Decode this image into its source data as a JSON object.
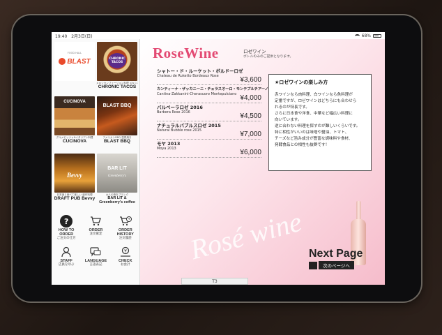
{
  "statusbar": {
    "time": "19:40",
    "date": "2月3日(日)",
    "battery": "68%"
  },
  "sidebar": {
    "restaurants": [
      {
        "sub": "FOOD HALL",
        "name": "BLAST",
        "logo": true
      },
      {
        "sub": "メキシカンフュージョン料理 メキシコタコス",
        "name": "CHRONIC TACOS",
        "badge": "CHRONIC TACOS"
      },
      {
        "sub": "グルメピッツァ&イタリアン料理",
        "name": "CUCINOVA",
        "label": "CUCINOVA"
      },
      {
        "sub": "アメリカンBBQ 温泉焼き",
        "name": "BLAST BBQ",
        "label": "BLAST BBQ"
      },
      {
        "sub": "日本酒と食べて楽しい 創作料理",
        "name": "DRAFT PUB Bevvy",
        "label": "Bevvy"
      },
      {
        "sub": "大人の夜をブランク",
        "name": "BAR LIT & Greenberry's coffee",
        "label": "BAR LIT",
        "label2": "Greenberry's"
      }
    ],
    "actions_row1": [
      {
        "en": "HOW TO ORDER",
        "jp": "ご注文の仕方",
        "icon": "help-icon"
      },
      {
        "en": "ORDER",
        "jp": "注文確定",
        "icon": "cart-icon"
      },
      {
        "en": "ORDER HISTORY",
        "jp": "注文履歴",
        "icon": "history-icon"
      }
    ],
    "actions_row2": [
      {
        "en": "STAFF",
        "jp": "店員を呼ぶ",
        "icon": "staff-icon"
      },
      {
        "en": "LANGUAGE",
        "jp": "言語表記",
        "icon": "language-icon"
      },
      {
        "en": "CHECK",
        "jp": "お会計",
        "icon": "check-icon"
      }
    ]
  },
  "main": {
    "title": "RoseWine",
    "title_jp": "ロゼワイン",
    "subtitle": "ボトルのみのご提供となります。",
    "wines": [
      {
        "jp": "シャトー・ド・ルーケット・ボルドーロゼ",
        "en": "Chateau de Ruketto Bordeaux Rose",
        "price": "¥3,600"
      },
      {
        "jp": "カンティーナ・ザッカニーニ・チェラスオーロ・モンテプルチアーノ",
        "en": "Cantina-Zakkanini-Cherasuoro Montepulciano",
        "price": "¥4,000"
      },
      {
        "jp": "バルベーラロゼ 2016",
        "en": "Barbera Rose 2016",
        "price": "¥4,500"
      },
      {
        "jp": "ナチュラルバブルスロゼ 2015",
        "en": "Natural Bubble rose 2015",
        "price": "¥7,000"
      },
      {
        "jp": "モヤ 2013",
        "en": "Moya 2013",
        "price": "¥6,000"
      }
    ],
    "info": {
      "heading": "★ロゼワインの楽しみ方",
      "lines": [
        "赤ワインなら肉料理、白ワインなら魚料理が",
        "定番ですが、ロゼワインはどちらにも合わせら",
        "れるのが特長です。",
        "さらに日本食や洋食、中華など幅広い料理に",
        "向いています。",
        "逆に合わない料理を探すのが難しいくらいです。",
        "特に相性がいいのは味噌や醤油、トマト、",
        "チーズなど旨み成分が豊富な調味料や食材、",
        "発酵食品との相性も抜群です！"
      ]
    },
    "decor_text": "Rosé wine",
    "next_page": {
      "en": "Next Page",
      "jp": "次のページへ"
    },
    "table": "T3"
  },
  "colors": {
    "accent": "#e34a73",
    "brand_blast": "#e94a2b"
  }
}
